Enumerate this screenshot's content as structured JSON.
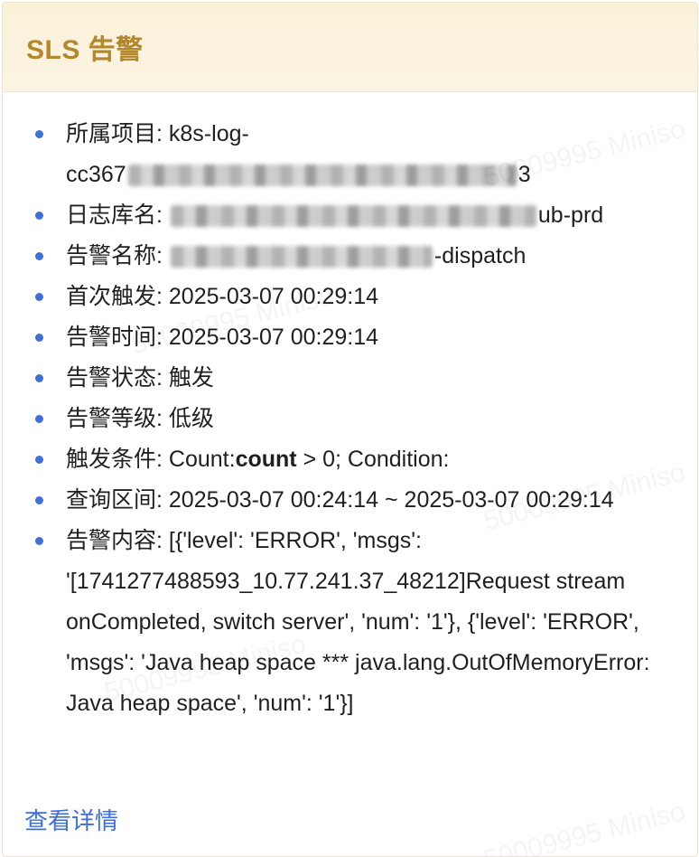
{
  "header": {
    "title": "SLS 告警"
  },
  "fields": {
    "project": {
      "label": "所属项目:",
      "value_start": "k8s-log-",
      "value_line2_start": "cc367",
      "value_end": "3"
    },
    "logstore": {
      "label": "日志库名:",
      "value_end": "ub-prd"
    },
    "alert_name": {
      "label": "告警名称:",
      "value_end": "-dispatch"
    },
    "first_trigger": {
      "label": "首次触发:",
      "value": "2025-03-07 00:29:14"
    },
    "alert_time": {
      "label": "告警时间:",
      "value": "2025-03-07 00:29:14"
    },
    "alert_status": {
      "label": "告警状态:",
      "value": "触发"
    },
    "alert_level": {
      "label": "告警等级:",
      "value": "低级"
    },
    "trigger_condition": {
      "label": "触发条件:",
      "prefix": "Count:",
      "bold": "count",
      "suffix": " > 0; Condition:"
    },
    "query_range": {
      "label": "查询区间:",
      "value": "2025-03-07 00:24:14 ~ 2025-03-07 00:29:14"
    },
    "alert_content": {
      "label": "告警内容:",
      "value": "[{'level': 'ERROR', 'msgs': '[1741277488593_10.77.241.37_48212]Request stream onCompleted, switch server', 'num': '1'}, {'level': 'ERROR', 'msgs': 'Java heap space *** java.lang.OutOfMemoryError: Java heap space', 'num': '1'}]"
    }
  },
  "link": {
    "detail": "查看详情"
  },
  "watermark": {
    "text": "50009995 Miniso"
  },
  "colors": {
    "accent": "#b3872c",
    "bullet": "#3f6fd9",
    "link": "#3c6fd8",
    "header_bg": "#faf1d8"
  }
}
